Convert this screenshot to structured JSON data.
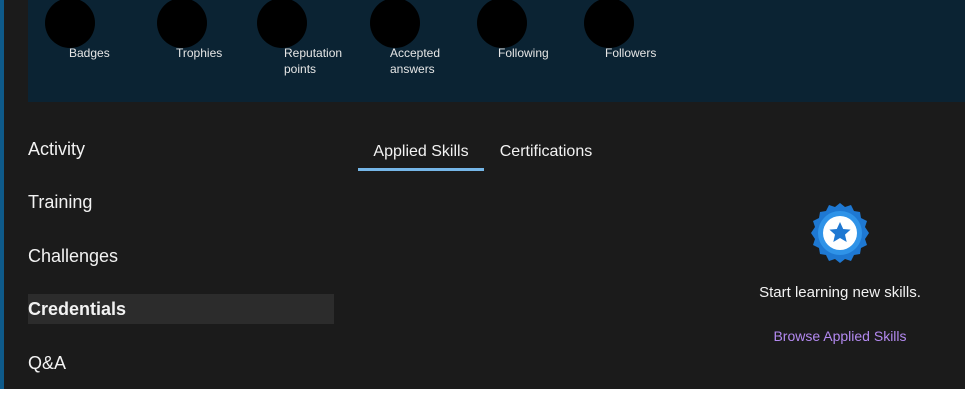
{
  "stats": [
    {
      "label": "Badges"
    },
    {
      "label": "Trophies"
    },
    {
      "label": "Reputation\npoints"
    },
    {
      "label": "Accepted\nanswers"
    },
    {
      "label": "Following"
    },
    {
      "label": "Followers"
    }
  ],
  "nav": {
    "items": [
      {
        "label": "Activity",
        "active": false
      },
      {
        "label": "Training",
        "active": false
      },
      {
        "label": "Challenges",
        "active": false
      },
      {
        "label": "Credentials",
        "active": true
      },
      {
        "label": "Q&A",
        "active": false
      }
    ]
  },
  "tabs": [
    {
      "label": "Applied Skills",
      "active": true
    },
    {
      "label": "Certifications",
      "active": false
    }
  ],
  "empty_state": {
    "icon": "star-badge-icon",
    "message": "Start learning new skills.",
    "link": "Browse Applied Skills"
  },
  "colors": {
    "banner": "#0b2333",
    "tab_underline": "#75b6e7",
    "link": "#b389f0",
    "badge_blue": "#1e78d2"
  }
}
